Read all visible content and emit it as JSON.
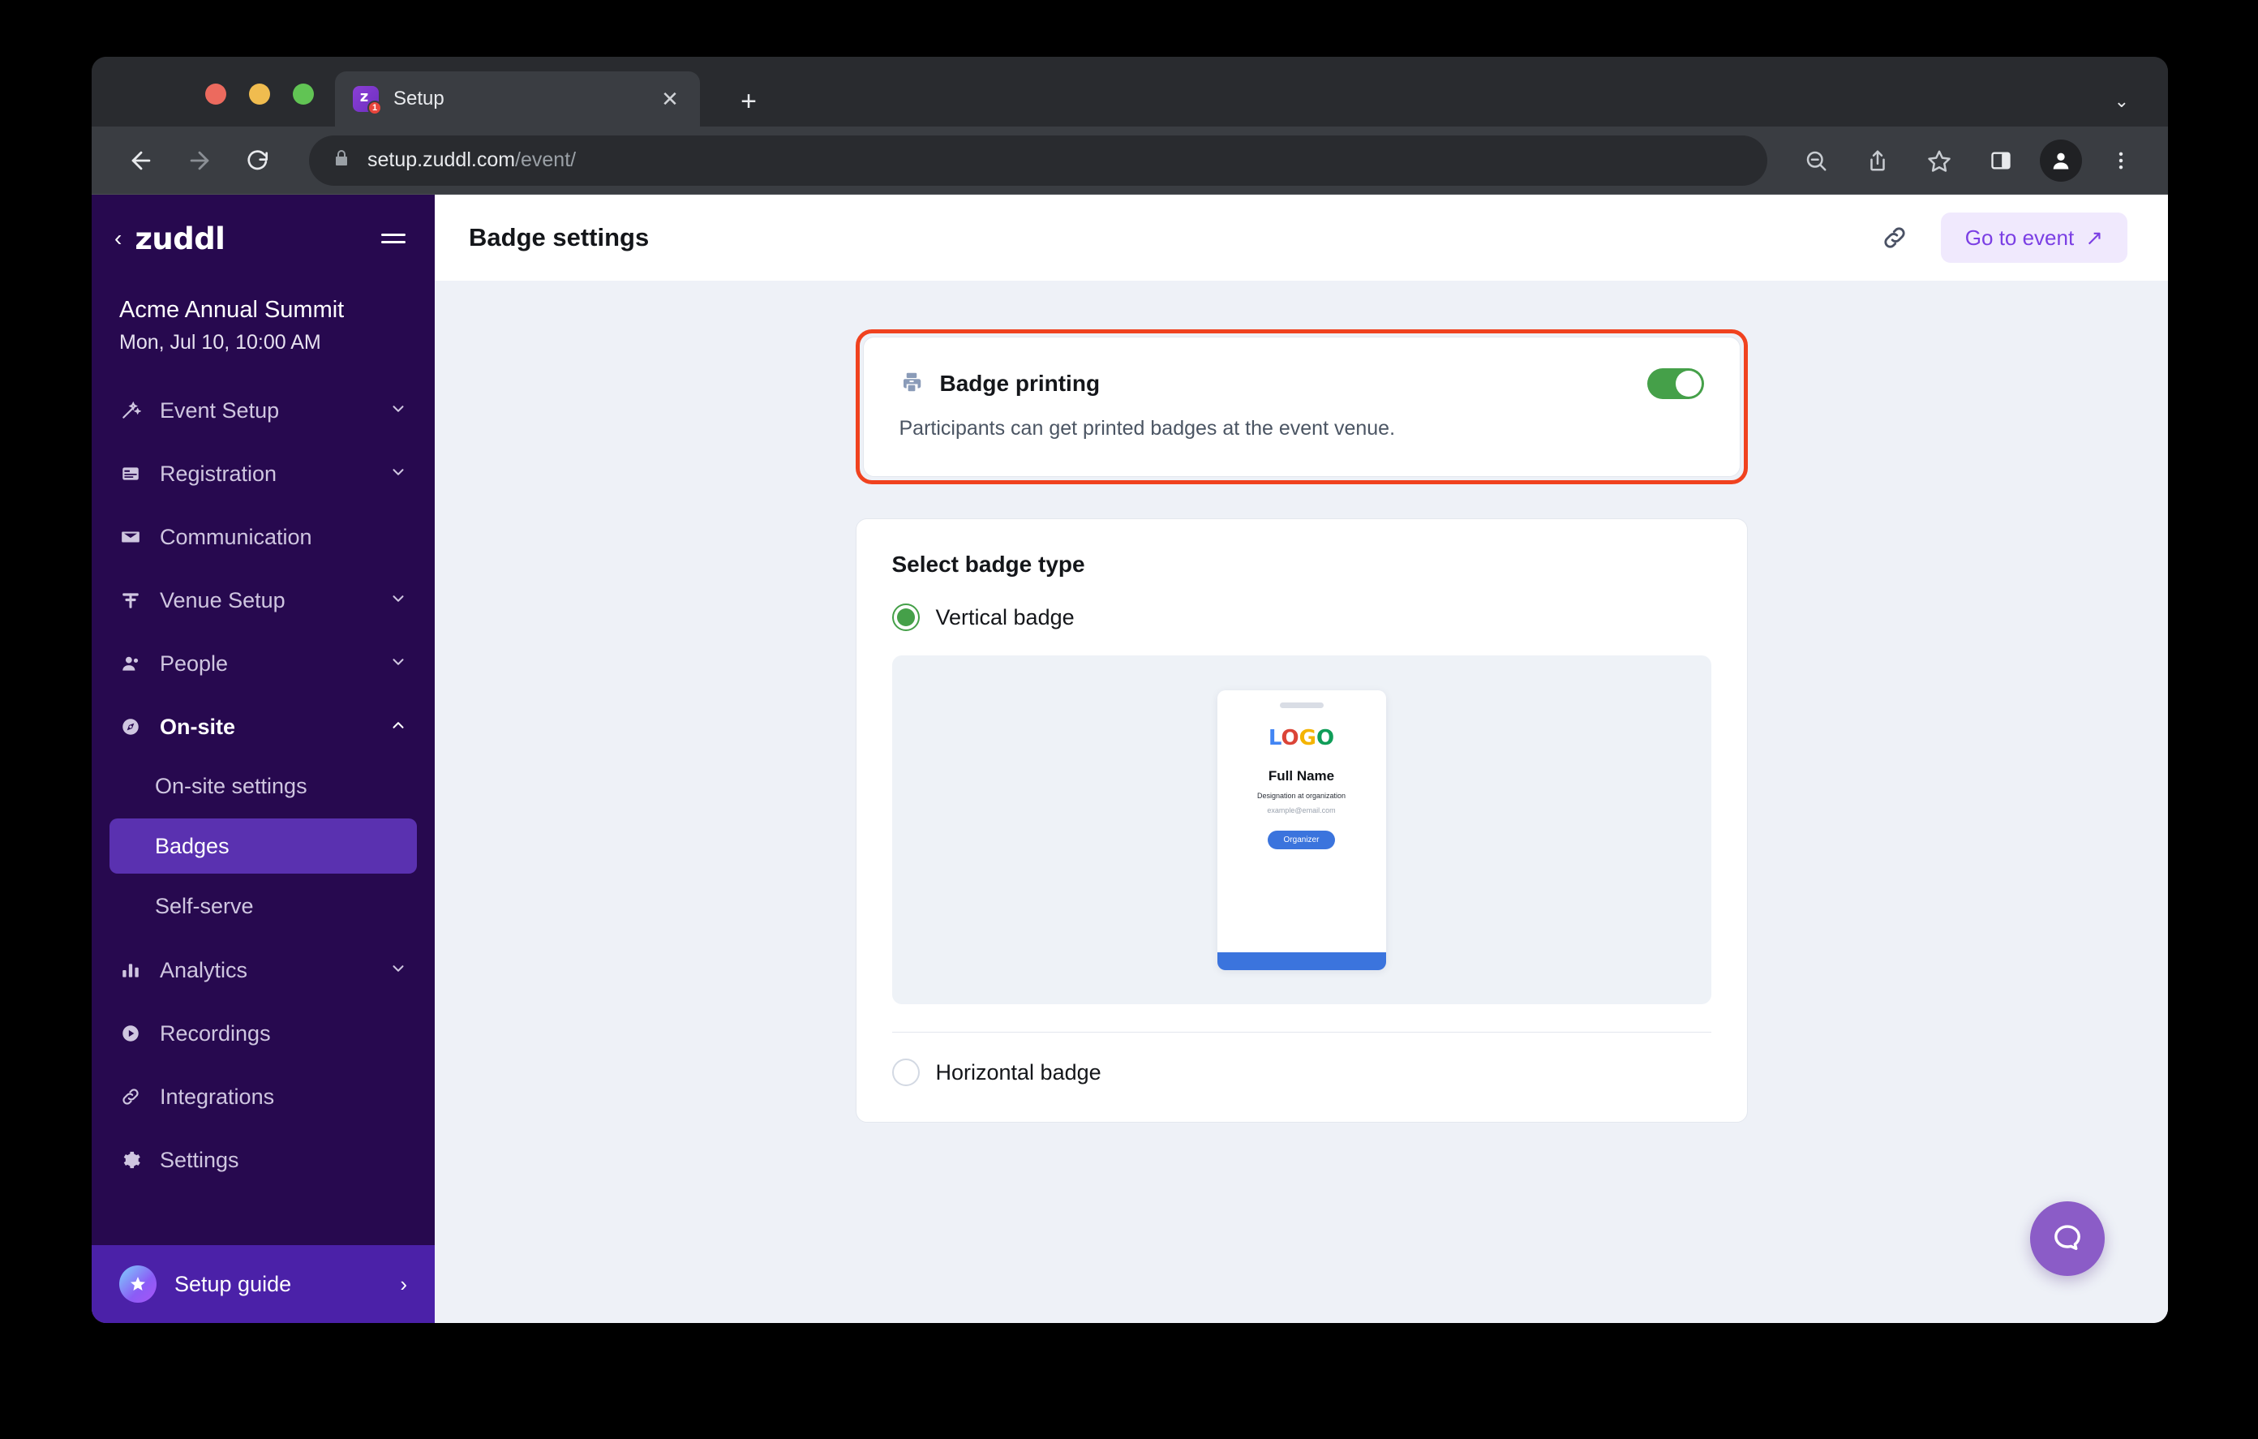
{
  "browser": {
    "tab": {
      "title": "Setup",
      "favicon_letter": "z",
      "badge_count": "1",
      "close_label": "✕"
    },
    "new_tab_label": "+",
    "tabstrip_chevron": "⌄",
    "url": {
      "domain": "setup.zuddl.com",
      "path": "/event/"
    },
    "icons": {
      "back": "back-arrow-icon",
      "forward": "forward-arrow-icon",
      "reload": "reload-icon",
      "lock": "lock-icon",
      "zoom_out": "zoom-out-icon",
      "share": "share-icon",
      "bookmark": "star-icon",
      "side_panel": "side-panel-icon",
      "profile": "profile-avatar-icon",
      "menu": "three-dot-menu-icon"
    }
  },
  "sidebar": {
    "brand": "zuddl",
    "back_chevron": "‹",
    "event_name": "Acme Annual Summit",
    "event_date": "Mon, Jul 10, 10:00 AM",
    "nav": [
      {
        "label": "Event Setup",
        "icon": "magic-wand-icon",
        "expandable": true,
        "state": "collapsed"
      },
      {
        "label": "Registration",
        "icon": "form-icon",
        "expandable": true,
        "state": "collapsed"
      },
      {
        "label": "Communication",
        "icon": "envelope-icon",
        "expandable": false,
        "state": ""
      },
      {
        "label": "Venue Setup",
        "icon": "layout-icon",
        "expandable": true,
        "state": "collapsed"
      },
      {
        "label": "People",
        "icon": "person-icon",
        "expandable": true,
        "state": "collapsed"
      },
      {
        "label": "On-site",
        "icon": "compass-icon",
        "expandable": true,
        "state": "expanded"
      }
    ],
    "subnav": [
      {
        "label": "On-site settings",
        "selected": false
      },
      {
        "label": "Badges",
        "selected": true
      },
      {
        "label": "Self-serve",
        "selected": false
      }
    ],
    "nav_bottom": [
      {
        "label": "Analytics",
        "icon": "bar-chart-icon",
        "expandable": true,
        "state": "collapsed"
      },
      {
        "label": "Recordings",
        "icon": "play-circle-icon",
        "expandable": false,
        "state": ""
      },
      {
        "label": "Integrations",
        "icon": "link-icon",
        "expandable": false,
        "state": ""
      },
      {
        "label": "Settings",
        "icon": "gear-icon",
        "expandable": false,
        "state": ""
      }
    ],
    "setup_guide": {
      "label": "Setup guide",
      "chevron": "›",
      "icon": "star-icon"
    }
  },
  "header": {
    "title": "Badge settings",
    "link_icon": "link-icon",
    "go_to_event": {
      "label": "Go to event",
      "arrow": "↗"
    }
  },
  "badge_printing": {
    "icon": "printer-icon",
    "title": "Badge printing",
    "description": "Participants can get printed badges at the event venue.",
    "toggle_on": true,
    "highlight_color": "#f0421f",
    "toggle_color": "#45a049"
  },
  "badge_type": {
    "section_title": "Select badge type",
    "options": [
      {
        "label": "Vertical badge",
        "selected": true
      },
      {
        "label": "Horizontal badge",
        "selected": false
      }
    ],
    "preview": {
      "logo_letters": [
        "L",
        "O",
        "G",
        "O"
      ],
      "logo_colors": [
        "#4285f4",
        "#db4437",
        "#f4b400",
        "#0f9d58"
      ],
      "full_name": "Full Name",
      "designation": "Designation at organization",
      "email": "example@email.com",
      "role_pill": "Organizer",
      "accent_color": "#3b74dd"
    }
  },
  "help_widget": {
    "icon": "chat-bubble-icon",
    "color": "#8b5cc7"
  }
}
